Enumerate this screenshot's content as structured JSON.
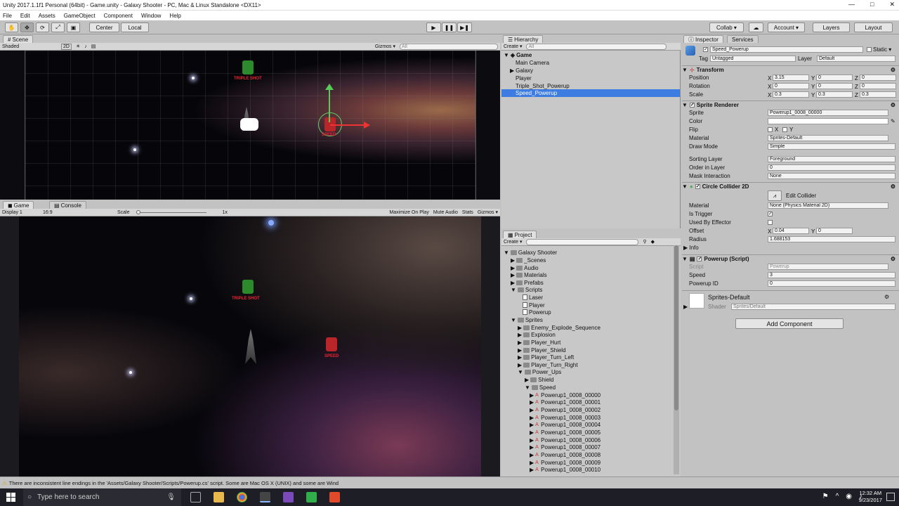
{
  "window": {
    "title": "Unity 2017.1.1f1 Personal (64bit) - Game.unity - Galaxy Shooter - PC, Mac & Linux Standalone <DX11>",
    "minimize": "—",
    "maximize": "□",
    "close": "✕"
  },
  "menu": [
    "File",
    "Edit",
    "Assets",
    "GameObject",
    "Component",
    "Window",
    "Help"
  ],
  "toolbar": {
    "center": "Center",
    "local": "Local",
    "collab": "Collab ▾",
    "account": "Account ▾",
    "layers": "Layers",
    "layout": "Layout"
  },
  "scene": {
    "tab": "Scene",
    "shading": "Shaded",
    "mode2d": "2D",
    "gizmos": "Gizmos ▾",
    "search_placeholder": "All"
  },
  "scene_objects": {
    "powerup1_label": "TRIPLE SHOT",
    "powerup2_label": "SPEED"
  },
  "game": {
    "tab": "Game",
    "console_tab": "Console",
    "display": "Display 1",
    "aspect": "16:9",
    "scale_label": "Scale",
    "scale_value": "1x",
    "maximize": "Maximize On Play",
    "mute": "Mute Audio",
    "stats": "Stats",
    "gizmos": "Gizmos ▾",
    "triple_label": "TRIPLE SHOT",
    "speed_label": "SPEED"
  },
  "hierarchy": {
    "tab": "Hierarchy",
    "create": "Create ▾",
    "search_placeholder": "All",
    "root": "Game",
    "items": [
      "Main Camera",
      "Galaxy",
      "Player",
      "Triple_Shot_Powerup",
      "Speed_Powerup"
    ],
    "selected_index": 4
  },
  "project": {
    "tab": "Project",
    "create": "Create ▾",
    "root": "Galaxy Shooter",
    "folders": [
      "_Scenes",
      "Audio",
      "Materials",
      "Prefabs",
      "Scripts"
    ],
    "scripts": [
      "Laser",
      "Player",
      "Powerup"
    ],
    "sprites_folder": "Sprites",
    "sprite_folders": [
      "Enemy_Explode_Sequence",
      "Explosion",
      "Player_Hurt",
      "Player_Shield",
      "Player_Turn_Left",
      "Player_Turn_Right",
      "Power_Ups"
    ],
    "powerup_folders": [
      "Shield",
      "Speed"
    ],
    "speed_sprites": [
      "Powerup1_0008_00000",
      "Powerup1_0008_00001",
      "Powerup1_0008_00002",
      "Powerup1_0008_00003",
      "Powerup1_0008_00004",
      "Powerup1_0008_00005",
      "Powerup1_0008_00006",
      "Powerup1_0008_00007",
      "Powerup1_0008_00008",
      "Powerup1_0008_00009",
      "Powerup1_0008_00010"
    ]
  },
  "inspector": {
    "tab": "Inspector",
    "services_tab": "Services",
    "object_name": "Speed_Powerup",
    "static": "Static ▾",
    "tag_label": "Tag",
    "tag_value": "Untagged",
    "layer_label": "Layer",
    "layer_value": "Default",
    "transform": {
      "title": "Transform",
      "position": "Position",
      "rotation": "Rotation",
      "scale": "Scale",
      "pos": [
        "3.15",
        "0",
        "0"
      ],
      "rot": [
        "0",
        "0",
        "0"
      ],
      "scl": [
        "0.3",
        "0.3",
        "0.3"
      ],
      "x": "X",
      "y": "Y",
      "z": "Z"
    },
    "sprite_renderer": {
      "title": "Sprite Renderer",
      "sprite_label": "Sprite",
      "sprite_value": "Powerup1_0008_00000",
      "color_label": "Color",
      "flip_label": "Flip",
      "flip_x": "X",
      "flip_y": "Y",
      "material_label": "Material",
      "material_value": "Sprites-Default",
      "draw_mode_label": "Draw Mode",
      "draw_mode_value": "Simple",
      "sorting_layer_label": "Sorting Layer",
      "sorting_layer_value": "Foreground",
      "order_label": "Order in Layer",
      "order_value": "0",
      "mask_label": "Mask Interaction",
      "mask_value": "None"
    },
    "collider": {
      "title": "Circle Collider 2D",
      "edit": "Edit Collider",
      "material_label": "Material",
      "material_value": "None (Physics Material 2D)",
      "trigger_label": "Is Trigger",
      "effector_label": "Used By Effector",
      "offset_label": "Offset",
      "offset_x": "0.04",
      "offset_y": "0",
      "radius_label": "Radius",
      "radius_value": "1.688153",
      "info": "Info"
    },
    "script": {
      "title": "Powerup (Script)",
      "script_label": "Script",
      "script_value": "Powerup",
      "speed_label": "Speed",
      "speed_value": "3",
      "id_label": "Powerup ID",
      "id_value": "0"
    },
    "material": {
      "name": "Sprites-Default",
      "shader_label": "Shader",
      "shader_value": "Sprites/Default"
    },
    "add_component": "Add Component"
  },
  "status": {
    "message": "There are inconsistent line endings in the 'Assets/Galaxy Shooter/Scripts/Powerup.cs' script. Some are Mac OS X (UNIX) and some are Wind"
  },
  "taskbar": {
    "search": "Type here to search",
    "time": "12:32 AM",
    "date": "9/23/2017"
  },
  "colors": {
    "selection": "#3d7ce0",
    "panel": "#c2c2c2",
    "taskbar": "#1e1e26"
  }
}
